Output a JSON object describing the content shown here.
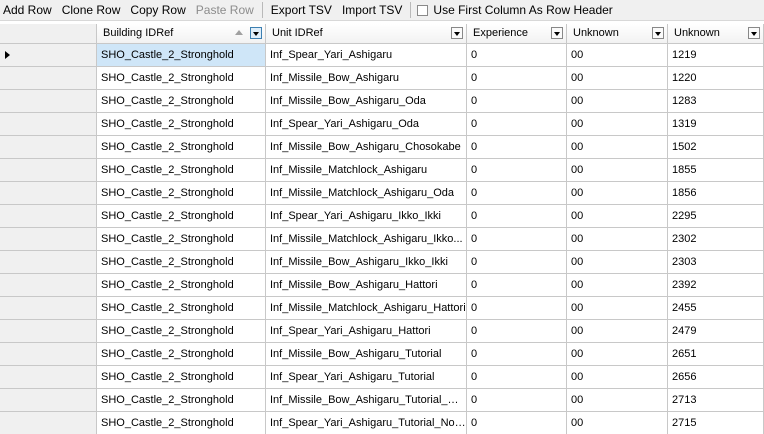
{
  "toolbar": {
    "add_row": "Add Row",
    "clone_row": "Clone Row",
    "copy_row": "Copy Row",
    "paste_row": "Paste Row",
    "export_tsv": "Export TSV",
    "import_tsv": "Import TSV",
    "first_column_header": "Use First Column As Row Header"
  },
  "grid": {
    "columns": [
      "Building IDRef",
      "Unit IDRef",
      "Experience",
      "Unknown",
      "Unknown"
    ],
    "rows": [
      [
        "SHO_Castle_2_Stronghold",
        "Inf_Spear_Yari_Ashigaru",
        "0",
        "00",
        "1219"
      ],
      [
        "SHO_Castle_2_Stronghold",
        "Inf_Missile_Bow_Ashigaru",
        "0",
        "00",
        "1220"
      ],
      [
        "SHO_Castle_2_Stronghold",
        "Inf_Missile_Bow_Ashigaru_Oda",
        "0",
        "00",
        "1283"
      ],
      [
        "SHO_Castle_2_Stronghold",
        "Inf_Spear_Yari_Ashigaru_Oda",
        "0",
        "00",
        "1319"
      ],
      [
        "SHO_Castle_2_Stronghold",
        "Inf_Missile_Bow_Ashigaru_Chosokabe",
        "0",
        "00",
        "1502"
      ],
      [
        "SHO_Castle_2_Stronghold",
        "Inf_Missile_Matchlock_Ashigaru",
        "0",
        "00",
        "1855"
      ],
      [
        "SHO_Castle_2_Stronghold",
        "Inf_Missile_Matchlock_Ashigaru_Oda",
        "0",
        "00",
        "1856"
      ],
      [
        "SHO_Castle_2_Stronghold",
        "Inf_Spear_Yari_Ashigaru_Ikko_Ikki",
        "0",
        "00",
        "2295"
      ],
      [
        "SHO_Castle_2_Stronghold",
        "Inf_Missile_Matchlock_Ashigaru_Ikko...",
        "0",
        "00",
        "2302"
      ],
      [
        "SHO_Castle_2_Stronghold",
        "Inf_Missile_Bow_Ashigaru_Ikko_Ikki",
        "0",
        "00",
        "2303"
      ],
      [
        "SHO_Castle_2_Stronghold",
        "Inf_Missile_Bow_Ashigaru_Hattori",
        "0",
        "00",
        "2392"
      ],
      [
        "SHO_Castle_2_Stronghold",
        "Inf_Missile_Matchlock_Ashigaru_Hattori",
        "0",
        "00",
        "2455"
      ],
      [
        "SHO_Castle_2_Stronghold",
        "Inf_Spear_Yari_Ashigaru_Hattori",
        "0",
        "00",
        "2479"
      ],
      [
        "SHO_Castle_2_Stronghold",
        "Inf_Missile_Bow_Ashigaru_Tutorial",
        "0",
        "00",
        "2651"
      ],
      [
        "SHO_Castle_2_Stronghold",
        "Inf_Spear_Yari_Ashigaru_Tutorial",
        "0",
        "00",
        "2656"
      ],
      [
        "SHO_Castle_2_Stronghold",
        "Inf_Missile_Bow_Ashigaru_Tutorial_No...",
        "0",
        "00",
        "2713"
      ],
      [
        "SHO_Castle_2_Stronghold",
        "Inf_Spear_Yari_Ashigaru_Tutorial_No_...",
        "0",
        "00",
        "2715"
      ]
    ]
  }
}
